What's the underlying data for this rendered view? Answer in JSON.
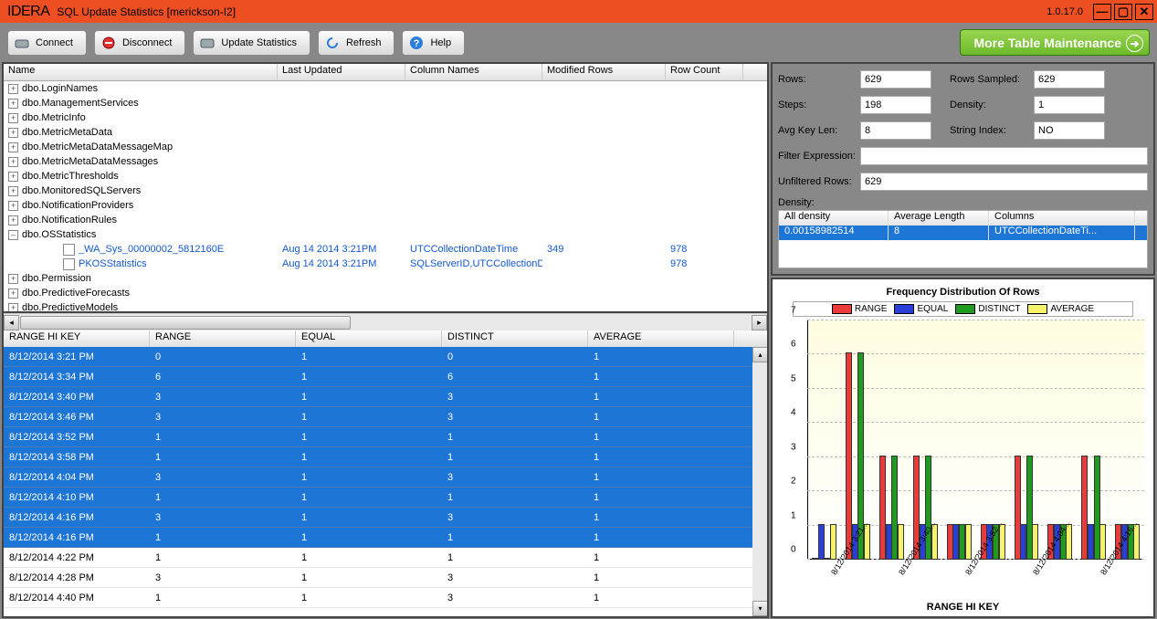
{
  "titlebar": {
    "logo": "IDERA",
    "title": "SQL Update Statistics [merickson-I2]",
    "version": "1.0.17.0"
  },
  "toolbar": {
    "connect": "Connect",
    "disconnect": "Disconnect",
    "update": "Update Statistics",
    "refresh": "Refresh",
    "help": "Help",
    "more": "More Table Maintenance"
  },
  "tree": {
    "headers": {
      "name": "Name",
      "last_updated": "Last Updated",
      "column_names": "Column Names",
      "modified_rows": "Modified Rows",
      "row_count": "Row Count"
    },
    "items": [
      {
        "label": "dbo.LoginNames",
        "exp": "+"
      },
      {
        "label": "dbo.ManagementServices",
        "exp": "+"
      },
      {
        "label": "dbo.MetricInfo",
        "exp": "+"
      },
      {
        "label": "dbo.MetricMetaData",
        "exp": "+"
      },
      {
        "label": "dbo.MetricMetaDataMessageMap",
        "exp": "+"
      },
      {
        "label": "dbo.MetricMetaDataMessages",
        "exp": "+"
      },
      {
        "label": "dbo.MetricThresholds",
        "exp": "+"
      },
      {
        "label": "dbo.MonitoredSQLServers",
        "exp": "+"
      },
      {
        "label": "dbo.NotificationProviders",
        "exp": "+"
      },
      {
        "label": "dbo.NotificationRules",
        "exp": "+"
      },
      {
        "label": "dbo.OSStatistics",
        "exp": "–",
        "children": [
          {
            "label": "_WA_Sys_00000002_5812160E",
            "last_updated": "Aug 14 2014  3:21PM",
            "cols": "UTCCollectionDateTime",
            "mod": "349",
            "rows": "978"
          },
          {
            "label": "PKOSStatistics",
            "last_updated": "Aug 14 2014  3:21PM",
            "cols": "SQLServerID,UTCCollectionDateTime",
            "mod": "",
            "rows": "978"
          }
        ]
      },
      {
        "label": "dbo.Permission",
        "exp": "+"
      },
      {
        "label": "dbo.PredictiveForecasts",
        "exp": "+"
      },
      {
        "label": "dbo.PredictiveModels",
        "exp": "+"
      }
    ]
  },
  "props": {
    "rows_l": "Rows:",
    "rows": "629",
    "rows_sampled_l": "Rows Sampled:",
    "rows_sampled": "629",
    "steps_l": "Steps:",
    "steps": "198",
    "density_l": "Density:",
    "density": "1",
    "avgkey_l": "Avg Key Len:",
    "avgkey": "8",
    "strindex_l": "String Index:",
    "strindex": "NO",
    "filter_l": "Filter Expression:",
    "filter": "",
    "unfilt_l": "Unfiltered Rows:",
    "unfilt": "629",
    "dens_section_l": "Density:",
    "dens_head": {
      "a": "All density",
      "b": "Average Length",
      "c": "Columns"
    },
    "dens_row": {
      "a": "0.00158982514",
      "b": "8",
      "c": "UTCCollectionDateTi..."
    }
  },
  "hist": {
    "headers": {
      "a": "RANGE HI KEY",
      "b": "RANGE",
      "c": "EQUAL",
      "d": "DISTINCT",
      "e": "AVERAGE"
    },
    "rows": [
      {
        "a": "8/12/2014 3:21 PM",
        "b": "0",
        "c": "1",
        "d": "0",
        "e": "1",
        "sel": true
      },
      {
        "a": "8/12/2014 3:34 PM",
        "b": "6",
        "c": "1",
        "d": "6",
        "e": "1",
        "sel": true
      },
      {
        "a": "8/12/2014 3:40 PM",
        "b": "3",
        "c": "1",
        "d": "3",
        "e": "1",
        "sel": true
      },
      {
        "a": "8/12/2014 3:46 PM",
        "b": "3",
        "c": "1",
        "d": "3",
        "e": "1",
        "sel": true
      },
      {
        "a": "8/12/2014 3:52 PM",
        "b": "1",
        "c": "1",
        "d": "1",
        "e": "1",
        "sel": true
      },
      {
        "a": "8/12/2014 3:58 PM",
        "b": "1",
        "c": "1",
        "d": "1",
        "e": "1",
        "sel": true
      },
      {
        "a": "8/12/2014 4:04 PM",
        "b": "3",
        "c": "1",
        "d": "3",
        "e": "1",
        "sel": true
      },
      {
        "a": "8/12/2014 4:10 PM",
        "b": "1",
        "c": "1",
        "d": "1",
        "e": "1",
        "sel": true
      },
      {
        "a": "8/12/2014 4:16 PM",
        "b": "3",
        "c": "1",
        "d": "3",
        "e": "1",
        "sel": true
      },
      {
        "a": "8/12/2014 4:16 PM",
        "b": "1",
        "c": "1",
        "d": "1",
        "e": "1",
        "sel": true
      },
      {
        "a": "8/12/2014 4:22 PM",
        "b": "1",
        "c": "1",
        "d": "1",
        "e": "1",
        "sel": false
      },
      {
        "a": "8/12/2014 4:28 PM",
        "b": "3",
        "c": "1",
        "d": "3",
        "e": "1",
        "sel": false
      },
      {
        "a": "8/12/2014 4:40 PM",
        "b": "1",
        "c": "1",
        "d": "3",
        "e": "1",
        "sel": false
      }
    ]
  },
  "chart_data": {
    "type": "bar",
    "title": "Frequency Distribution Of Rows",
    "xlabel": "RANGE HI KEY",
    "ylabel": "",
    "ylim": [
      0,
      7
    ],
    "categories": [
      "8/12/2014 3:21...",
      "8/12/2014 3:34...",
      "8/12/2014 3:40...",
      "8/12/2014 3:46...",
      "8/12/2014 3:52...",
      "8/12/2014 3:58...",
      "8/12/2014 4:04...",
      "8/12/2014 4:10...",
      "8/12/2014 4:16...",
      "8/12/2014 4:16..."
    ],
    "xtick_labels": [
      "8/12/2014 3:21...",
      "8/12/2014 3:40...",
      "8/12/2014 3:52...",
      "8/12/2014 4:04...",
      "8/12/2014 4:16..."
    ],
    "series": [
      {
        "name": "RANGE",
        "color": "#ea3b3b",
        "values": [
          0,
          6,
          3,
          3,
          1,
          1,
          3,
          1,
          3,
          1
        ]
      },
      {
        "name": "EQUAL",
        "color": "#2a3fd6",
        "values": [
          1,
          1,
          1,
          1,
          1,
          1,
          1,
          1,
          1,
          1
        ]
      },
      {
        "name": "DISTINCT",
        "color": "#1f9b1f",
        "values": [
          0,
          6,
          3,
          3,
          1,
          1,
          3,
          1,
          3,
          1
        ]
      },
      {
        "name": "AVERAGE",
        "color": "#f5f36b",
        "values": [
          1,
          1,
          1,
          1,
          1,
          1,
          1,
          1,
          1,
          1
        ]
      }
    ]
  }
}
